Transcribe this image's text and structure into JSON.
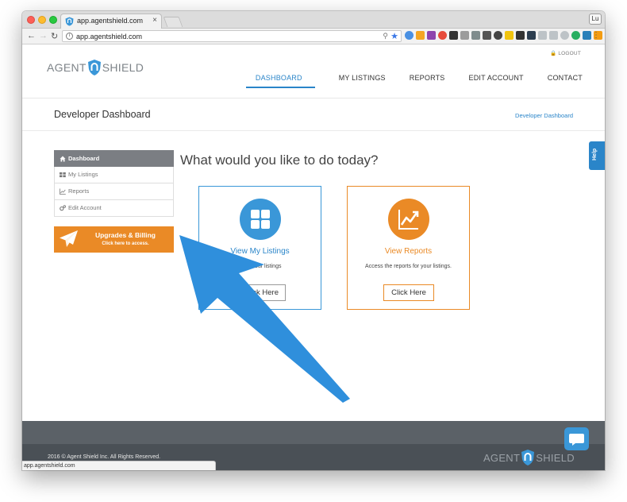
{
  "browser": {
    "tab_title": "app.agentshield.com",
    "tab_close": "×",
    "url": "app.agentshield.com",
    "user_initials": "Lu",
    "status_url": "app.agentshield.com"
  },
  "site": {
    "logout": "🔒 LOGOUT",
    "logo_left": "AGENT",
    "logo_right": "SHIELD",
    "nav": [
      "DASHBOARD",
      "MY LISTINGS",
      "REPORTS",
      "EDIT ACCOUNT",
      "CONTACT"
    ],
    "page_title": "Developer Dashboard",
    "breadcrumb": "Developer Dashboard",
    "sidebar": [
      {
        "label": "Dashboard",
        "icon": "home-icon"
      },
      {
        "label": "My Listings",
        "icon": "grid-icon"
      },
      {
        "label": "Reports",
        "icon": "chart-icon"
      },
      {
        "label": "Edit Account",
        "icon": "gears-icon"
      }
    ],
    "upgrade": {
      "title": "Upgrades & Billing",
      "subtitle": "Click here to access."
    },
    "question": "What would you like to do today?",
    "cards": [
      {
        "title": "View My Listings",
        "desc": "our listings",
        "button": "lick Here",
        "icon": "grid-icon"
      },
      {
        "title": "View Reports",
        "desc": "Access the reports for your listings.",
        "button": "Click Here",
        "icon": "line-chart-icon"
      }
    ],
    "help": "Help",
    "copyright": "2016 © Agent Shield Inc. All Rights Reserved."
  },
  "colors": {
    "blue": "#3a97d8",
    "orange": "#ea8a26",
    "sidebar_active": "#7b7e83",
    "footer": "#4a5056"
  }
}
